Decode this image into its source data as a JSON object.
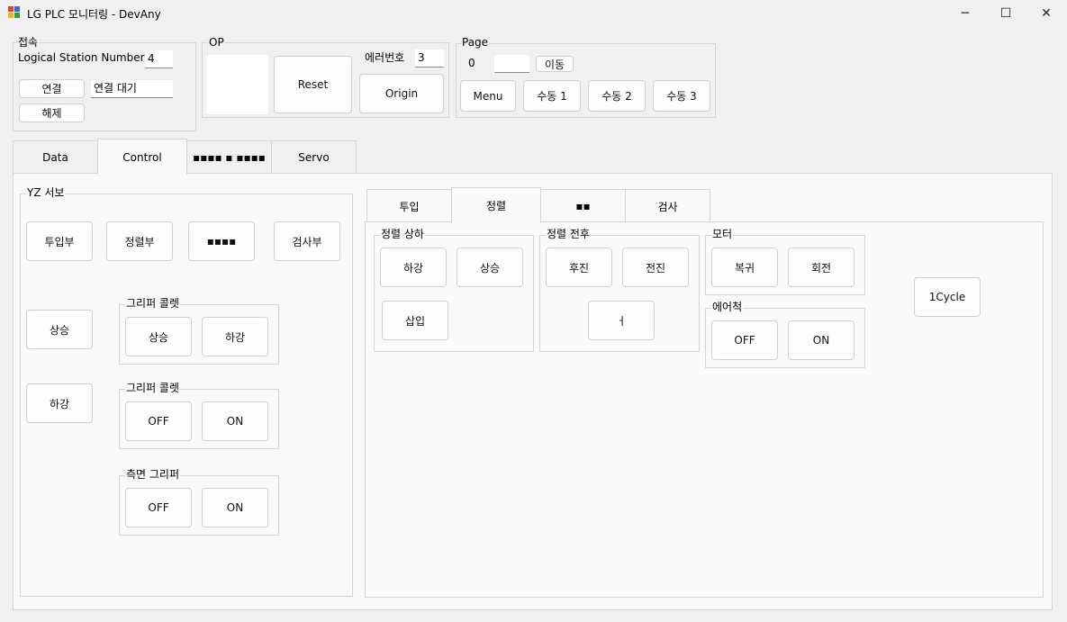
{
  "window": {
    "title": "LG PLC 모니터링 - DevAny",
    "minimize": "─",
    "maximize": "☐",
    "close": "✕"
  },
  "connect": {
    "group_label": "접속",
    "station_label": "Logical Station Number",
    "station_value": "4",
    "connect_button": "연결",
    "status_value": "연결 대기",
    "disconnect_button": "해제"
  },
  "op": {
    "group_label": "OP",
    "reset_button": "Reset",
    "error_label": "에러번호",
    "error_value": "3",
    "origin_button": "Origin"
  },
  "page": {
    "group_label": "Page",
    "current": "0",
    "input_value": "",
    "go_button": "이동",
    "menu_button": "Menu",
    "manual1": "수동 1",
    "manual2": "수동 2",
    "manual3": "수동 3"
  },
  "main_tabs": [
    "Data",
    "Control",
    "▪▪▪▪ ▪ ▪▪▪▪",
    "Servo"
  ],
  "yz": {
    "group_label": "YZ 서보",
    "buttons": [
      "투입부",
      "정렬부",
      "▪▪▪▪",
      "검사부"
    ],
    "up": "상승",
    "down": "하강",
    "gripper1": {
      "label": "그리퍼 콜렛",
      "a": "상승",
      "b": "하강"
    },
    "gripper2": {
      "label": "그리퍼 콜렛",
      "a": "OFF",
      "b": "ON"
    },
    "side": {
      "label": "측면 그리퍼",
      "a": "OFF",
      "b": "ON"
    }
  },
  "sub_tabs": [
    "투입",
    "정렬",
    "▪▪",
    "검사"
  ],
  "align": {
    "updown": {
      "label": "정렬 상하",
      "down": "하강",
      "up": "상승",
      "insert": "삽입"
    },
    "frontback": {
      "label": "정렬 전후",
      "back": "후진",
      "forward": "전진",
      "extra": "ㅓ"
    },
    "motor": {
      "label": "모터",
      "return": "복귀",
      "rotate": "회전"
    },
    "air": {
      "label": "에어척",
      "off": "OFF",
      "on": "ON"
    },
    "cycle": "1Cycle"
  }
}
